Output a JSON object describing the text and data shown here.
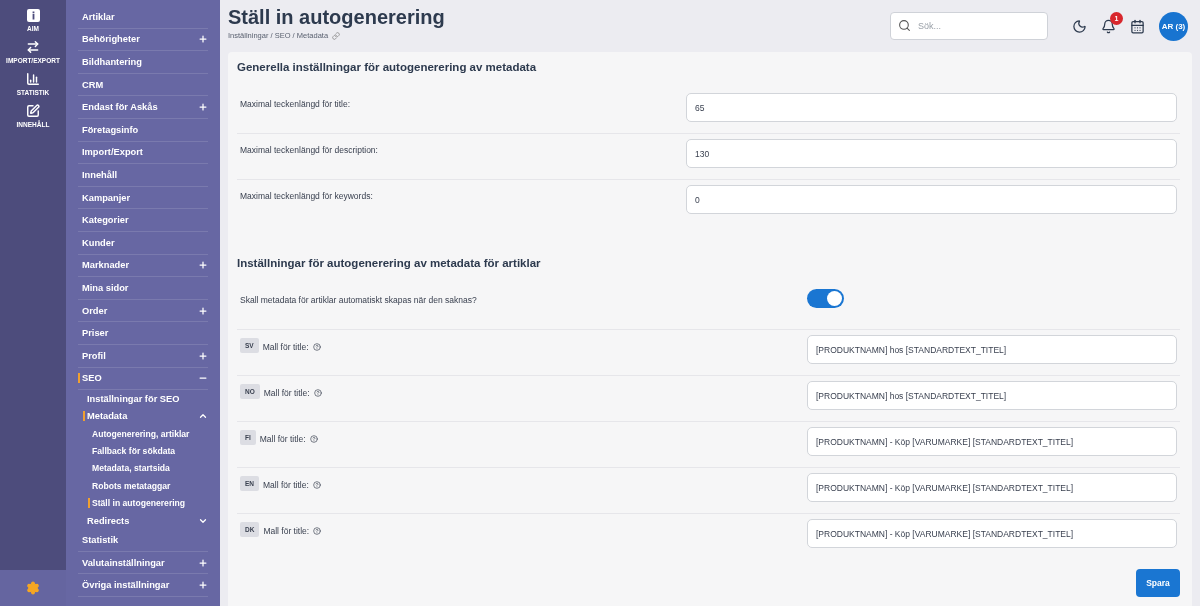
{
  "rail": {
    "items": [
      {
        "kind": "info",
        "label": "AIM"
      },
      {
        "kind": "transfer",
        "label": "IMPORT/EXPORT"
      },
      {
        "kind": "chart",
        "label": "STATISTIK"
      },
      {
        "kind": "edit",
        "label": "INNEHÅLL"
      }
    ]
  },
  "nav": {
    "items": [
      {
        "label": "Artiklar",
        "selected": false
      },
      {
        "label": "Behörigheter",
        "selected": false,
        "expanded": false
      },
      {
        "label": "Bildhantering",
        "selected": false
      },
      {
        "label": "CRM",
        "selected": false
      },
      {
        "label": "Endast för Askås",
        "selected": false,
        "expanded": false
      },
      {
        "label": "Företagsinfo",
        "selected": false
      },
      {
        "label": "Import/Export",
        "selected": false
      },
      {
        "label": "Innehåll",
        "selected": false
      },
      {
        "label": "Kampanjer",
        "selected": false
      },
      {
        "label": "Kategorier",
        "selected": false
      },
      {
        "label": "Kunder",
        "selected": false
      },
      {
        "label": "Marknader",
        "selected": false,
        "expanded": false
      },
      {
        "label": "Mina sidor",
        "selected": false
      },
      {
        "label": "Order",
        "selected": false,
        "expanded": false
      },
      {
        "label": "Priser",
        "selected": false
      },
      {
        "label": "Profil",
        "selected": false,
        "expanded": false
      },
      {
        "label": "SEO",
        "selected": true,
        "expanded": true,
        "children": [
          {
            "label": "Inställningar för SEO",
            "selected": false
          },
          {
            "label": "Metadata",
            "selected": true,
            "expanded": true,
            "children": [
              {
                "label": "Autogenerering, artiklar",
                "selected": false
              },
              {
                "label": "Fallback för sökdata",
                "selected": false
              },
              {
                "label": "Metadata, startsida",
                "selected": false
              },
              {
                "label": "Robots metataggar",
                "selected": false
              },
              {
                "label": "Ställ in autogenerering",
                "selected": true
              }
            ]
          },
          {
            "label": "Redirects",
            "selected": false,
            "expanded": false
          }
        ]
      },
      {
        "label": "Statistik",
        "selected": false
      },
      {
        "label": "Valutainställningar",
        "selected": false,
        "expanded": false
      },
      {
        "label": "Övriga inställningar",
        "selected": false,
        "expanded": false
      }
    ]
  },
  "header": {
    "title": "Ställ in autogenerering",
    "breadcrumb": "Inställningar / SEO / Metadata",
    "search": {
      "placeholder": "Sök..."
    },
    "notifications": "1",
    "avatar": "AR (3)"
  },
  "sections": [
    {
      "title": "Generella inställningar för autogenerering av metadata",
      "rows": [
        {
          "kind": "number",
          "label": "Maximal teckenlängd för title:",
          "value": "65"
        },
        {
          "kind": "number",
          "label": "Maximal teckenlängd för description:",
          "value": "130"
        },
        {
          "kind": "number",
          "label": "Maximal teckenlängd för keywords:",
          "value": "0"
        }
      ]
    },
    {
      "title": "Inställningar för autogenerering av metadata för artiklar",
      "rows": [
        {
          "kind": "toggle",
          "label": "Skall metadata för artiklar automatiskt skapas när den saknas?",
          "on": true
        },
        {
          "kind": "template",
          "lang": "SV",
          "label": "Mall för title:",
          "value": "[PRODUKTNAMN] hos [STANDARDTEXT_TITEL]"
        },
        {
          "kind": "template",
          "lang": "NO",
          "label": "Mall för title:",
          "value": "[PRODUKTNAMN] hos [STANDARDTEXT_TITEL]"
        },
        {
          "kind": "template",
          "lang": "FI",
          "label": "Mall för title:",
          "value": "[PRODUKTNAMN] - Köp [VARUMARKE] [STANDARDTEXT_TITEL]"
        },
        {
          "kind": "template",
          "lang": "EN",
          "label": "Mall för title:",
          "value": "[PRODUKTNAMN] - Köp [VARUMARKE] [STANDARDTEXT_TITEL]"
        },
        {
          "kind": "template",
          "lang": "DK",
          "label": "Mall för title:",
          "value": "[PRODUKTNAMN] - Köp [VARUMARKE] [STANDARDTEXT_TITEL]"
        }
      ]
    }
  ],
  "save_button": "Spara"
}
